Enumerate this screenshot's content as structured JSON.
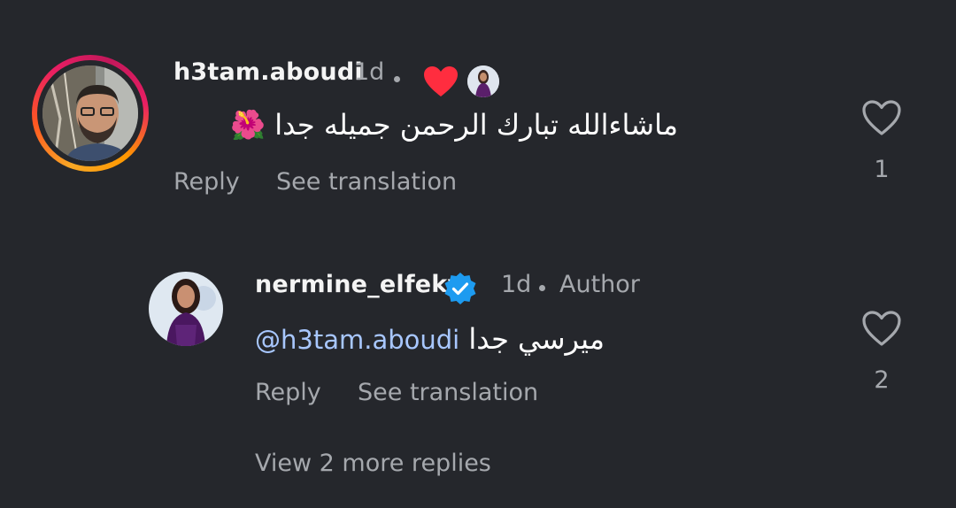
{
  "comments": [
    {
      "username": "h3tam.aboudi",
      "time": "1d",
      "text": "ماشاءالله تبارك الرحمن جميله جدا 🌺",
      "reply_label": "Reply",
      "translate_label": "See translation",
      "like_count": "1",
      "liked_by_author": true
    },
    {
      "username": "nermine_elfeky",
      "verified": true,
      "time": "1d",
      "author_badge": "Author",
      "mention": "@h3tam.aboudi",
      "text": "ميرسي جدا",
      "reply_label": "Reply",
      "translate_label": "See translation",
      "like_count": "2"
    }
  ],
  "view_more_label": "View 2 more replies",
  "icons": {
    "heart_liked": "heart-filled-icon",
    "heart_outline": "heart-outline-icon",
    "verified": "verified-badge-icon"
  },
  "colors": {
    "background": "#25272c",
    "secondary_text": "#a5a8ad",
    "verified_blue": "#1d9bf0",
    "liked_red": "#ff2d3f",
    "mention": "#a8c7ff"
  }
}
